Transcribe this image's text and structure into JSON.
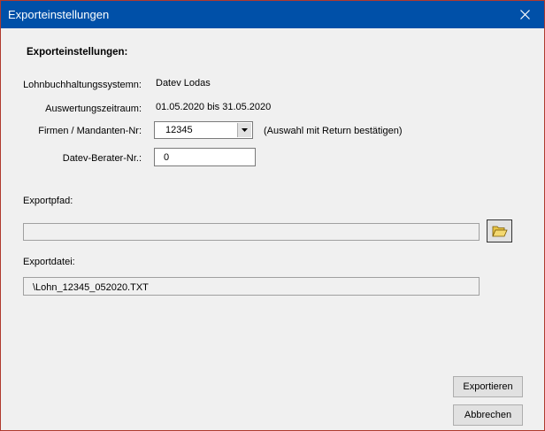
{
  "window": {
    "title": "Exporteinstellungen"
  },
  "form": {
    "heading": "Exporteinstellungen:",
    "system_label": "Lohnbuchhaltungssystemn:",
    "system_value": "Datev Lodas",
    "period_label": "Auswertungszeitraum:",
    "period_value": "01.05.2020 bis 31.05.2020",
    "company_label": "Firmen / Mandanten-Nr:",
    "company_value": "12345",
    "company_hint": "(Auswahl mit Return bestätigen)",
    "advisor_label": "Datev-Berater-Nr.:",
    "advisor_value": "0",
    "export_path_label": "Exportpfad:",
    "export_path_value": "",
    "export_file_label": "Exportdatei:",
    "export_file_value": "\\Lohn_12345_052020.TXT"
  },
  "buttons": {
    "export": "Exportieren",
    "cancel": "Abbrechen"
  },
  "icons": {
    "close": "close-icon",
    "browse": "open-folder-icon",
    "dropdown": "chevron-down-icon"
  },
  "colors": {
    "titlebar": "#0050a8",
    "window_border": "#b03a2e",
    "body": "#f0f0f0"
  }
}
